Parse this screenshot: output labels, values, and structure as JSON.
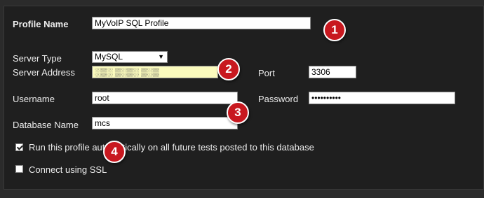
{
  "profile": {
    "name_label": "Profile Name",
    "name_value": "MyVoIP SQL Profile"
  },
  "server": {
    "type_label": "Server Type",
    "type_value": "MySQL",
    "address_label": "Server Address",
    "address_value": "░▒░ ▒░▒░ ▒░▒",
    "port_label": "Port",
    "port_value": "3306"
  },
  "auth": {
    "username_label": "Username",
    "username_value": "root",
    "password_label": "Password",
    "password_value": "••••••••••"
  },
  "database": {
    "label": "Database Name",
    "value": "mcs"
  },
  "options": {
    "run_auto_label": "Run this profile automatically on all future tests posted to this database",
    "run_auto_checked": true,
    "ssl_label": "Connect using SSL",
    "ssl_checked": false
  },
  "badges": [
    "1",
    "2",
    "3",
    "4"
  ],
  "colors": {
    "badge": "#c8181f",
    "panel": "#1f1f1f",
    "address_field": "#fbfbbd"
  }
}
